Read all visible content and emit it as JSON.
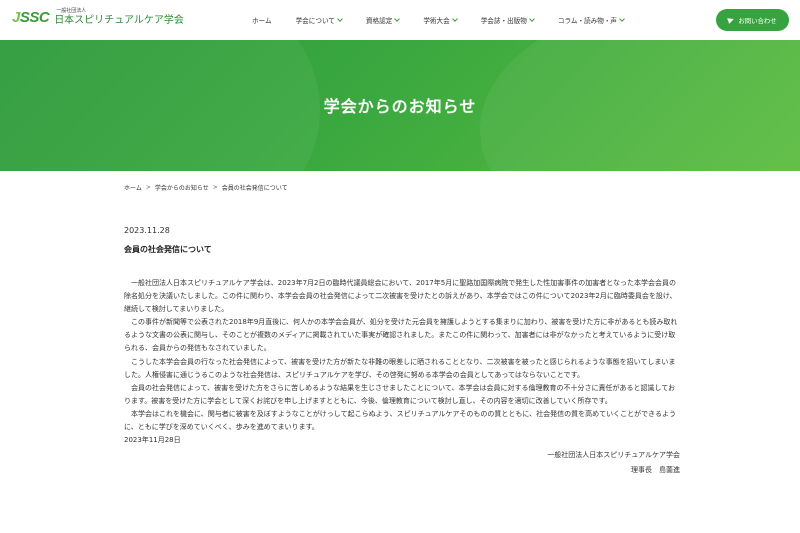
{
  "header": {
    "logo_mark_j": "J",
    "logo_mark_rest": "SSC",
    "logo_small": "一般社団法人",
    "logo_name": "日本スピリチュアルケア学会",
    "nav": [
      {
        "label": "ホーム",
        "has_dropdown": false
      },
      {
        "label": "学会について",
        "has_dropdown": true
      },
      {
        "label": "資格認定",
        "has_dropdown": true
      },
      {
        "label": "学術大会",
        "has_dropdown": true
      },
      {
        "label": "学会誌・出版物",
        "has_dropdown": true
      },
      {
        "label": "コラム・読み物・声",
        "has_dropdown": true
      }
    ],
    "contact_label": "お問い合わせ"
  },
  "hero": {
    "title": "学会からのお知らせ"
  },
  "breadcrumb": [
    "ホーム",
    "学会からのお知らせ",
    "会員の社会発信について"
  ],
  "breadcrumb_sep": ">",
  "post": {
    "date": "2023.11.28",
    "title": "会員の社会発信について",
    "paragraphs": [
      "一般社団法人日本スピリチュアルケア学会は、2023年7月2日の臨時代議員総会において、2017年5月に聖路加国際病院で発生した性加害事件の加害者となった本学会会員の除名処分を決議いたしました。この件に関わり、本学会会員の社会発信によって二次被害を受けたとの訴えがあり、本学会ではこの件について2023年2月に臨時委員会を設け、継続して検討してまいりました。",
      "この事件が新聞等で公表された2018年9月直後に、何人かの本学会会員が、処分を受けた元会員を擁護しようとする集まりに加わり、被害を受けた方に非があるとも読み取れるような文書の公表に関与し、そのことが複数のメディアに掲載されていた事実が確認されました。またこの件に関わって、加害者には非がなかったと考えているように受け取られる、会員からの発信もなされていました。",
      "こうした本学会会員の行なった社会発信によって、被害を受けた方が新たな非難の眼差しに晒されることとなり、二次被害を被ったと感じられるような事態を招いてしまいました。人権侵害に通じうるこのような社会発信は、スピリチュアルケアを学び、その啓発に努める本学会の会員としてあってはならないことです。",
      "会員の社会発信によって、被害を受けた方をさらに苦しめるような結果を生じさせましたことについて、本学会は会員に対する倫理教育の不十分さに責任があると認識しております。被害を受けた方に学会として深くお詫びを申し上げますとともに、今後、倫理教育について検討し直し、その内容を適切に改善していく所存です。",
      "本学会はこれを機会に、関与者に被害を及ぼすようなことがけっして起こらぬよう、スピリチュアルケアそのものの質とともに、社会発信の質を高めていくことができるように、ともに学びを深めていくべく、歩みを進めてまいります。"
    ],
    "end_date": "2023年11月28日",
    "signature_org": "一般社団法人日本スピリチュアルケア学会",
    "signature_person": "理事長　島薗進"
  },
  "colors": {
    "brand_green": "#36a33f",
    "hero_green": "#3aa83f"
  }
}
